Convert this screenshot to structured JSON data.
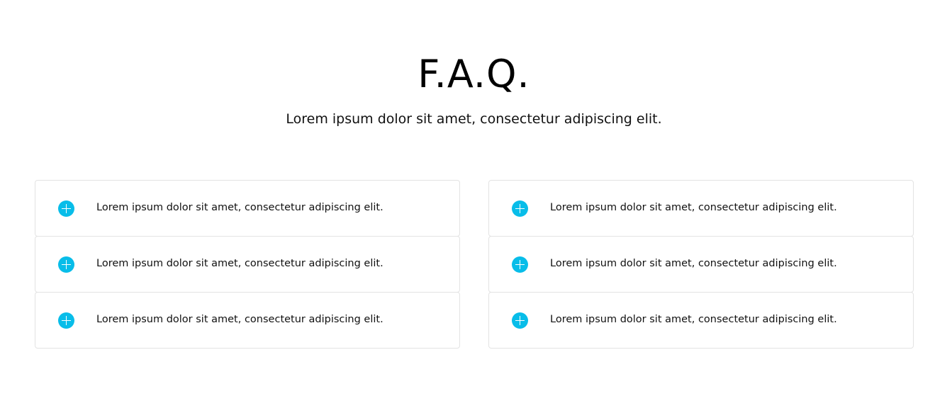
{
  "header": {
    "title": "F.A.Q.",
    "subtitle": "Lorem ipsum dolor sit amet, consectetur adipiscing elit."
  },
  "accent_color": "#08bde9",
  "columns": [
    {
      "items": [
        {
          "question": "Lorem ipsum dolor sit amet, consectetur adipiscing elit.",
          "icon": "plus-circle-icon"
        },
        {
          "question": "Lorem ipsum dolor sit amet, consectetur adipiscing elit.",
          "icon": "plus-circle-icon"
        },
        {
          "question": "Lorem ipsum dolor sit amet, consectetur adipiscing elit.",
          "icon": "plus-circle-icon"
        }
      ]
    },
    {
      "items": [
        {
          "question": "Lorem ipsum dolor sit amet, consectetur adipiscing elit.",
          "icon": "plus-circle-icon"
        },
        {
          "question": "Lorem ipsum dolor sit amet, consectetur adipiscing elit.",
          "icon": "plus-circle-icon"
        },
        {
          "question": "Lorem ipsum dolor sit amet, consectetur adipiscing elit.",
          "icon": "plus-circle-icon"
        }
      ]
    }
  ]
}
